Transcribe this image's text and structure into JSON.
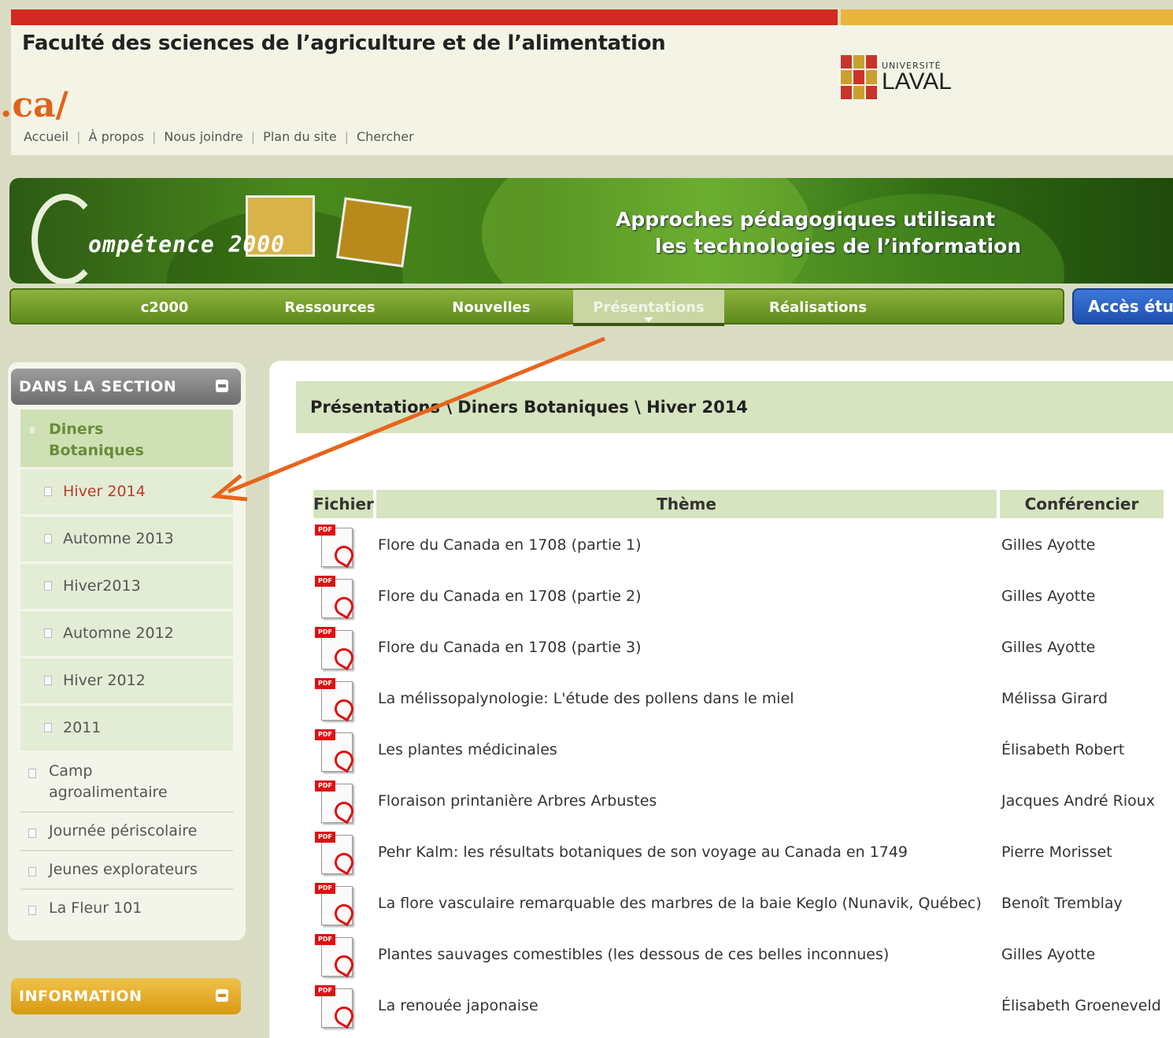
{
  "header": {
    "faculty": "Faculté des sciences de l’agriculture et de l’alimentation",
    "url_fragment": ".ca/",
    "logo": {
      "small": "UNIVERSITÉ",
      "large": "LAVAL"
    },
    "util_links": [
      "Accueil",
      "À propos",
      "Nous joindre",
      "Plan du site",
      "Chercher"
    ]
  },
  "banner": {
    "logo_text": "ompétence",
    "logo_year": "2000",
    "tagline_1": "Approches pédagogiques utilisant",
    "tagline_2": "les technologies de l’information"
  },
  "nav": {
    "items": [
      "c2000",
      "Ressources",
      "Nouvelles",
      "Présentations",
      "Réalisations"
    ],
    "active": "Présentations",
    "acces": "Accès étu"
  },
  "sidebar": {
    "title": "DANS LA SECTION",
    "section": "Diners Botaniques",
    "sub_items": [
      "Hiver 2014",
      "Automne 2013",
      "Hiver2013",
      "Automne 2012",
      "Hiver 2012",
      "2011"
    ],
    "current": "Hiver 2014",
    "other_items": [
      "Camp agroalimentaire",
      "Journée périscolaire",
      "Jeunes explorateurs",
      "La Fleur 101"
    ],
    "info_title": "INFORMATION"
  },
  "content": {
    "breadcrumb": "Présentations \\ Diners Botaniques \\ Hiver 2014",
    "columns": {
      "file": "Fichier",
      "theme": "Thème",
      "speaker": "Conférencier"
    },
    "rows": [
      {
        "theme": "Flore du Canada en 1708 (partie 1)",
        "speaker": "Gilles Ayotte"
      },
      {
        "theme": "Flore du Canada en 1708 (partie 2)",
        "speaker": "Gilles Ayotte"
      },
      {
        "theme": "Flore du Canada en 1708 (partie 3)",
        "speaker": "Gilles Ayotte"
      },
      {
        "theme": "La mélissopalynologie: L'étude des pollens dans le miel",
        "speaker": "Mélissa Girard"
      },
      {
        "theme": "Les plantes médicinales",
        "speaker": "Élisabeth Robert"
      },
      {
        "theme": "Floraison printanière Arbres Arbustes",
        "speaker": "Jacques André Rioux"
      },
      {
        "theme": "Pehr Kalm: les résultats botaniques de son voyage au Canada en 1749",
        "speaker": "Pierre Morisset"
      },
      {
        "theme": "La flore vasculaire remarquable des marbres de la baie Keglo (Nunavik, Québec)",
        "speaker": "Benoît Tremblay"
      },
      {
        "theme": "Plantes sauvages comestibles (les dessous de ces belles inconnues)",
        "speaker": "Gilles Ayotte"
      },
      {
        "theme": "La renouée japonaise",
        "speaker": "Élisabeth Groeneveld"
      }
    ],
    "pdf_tag": "PDF"
  },
  "colors": {
    "red_bar": "#d22a21",
    "gold_bar": "#e9b53c",
    "nav_green": "#6f9a26",
    "annotation_arrow": "#e8641c",
    "current_item": "#c0392b"
  }
}
